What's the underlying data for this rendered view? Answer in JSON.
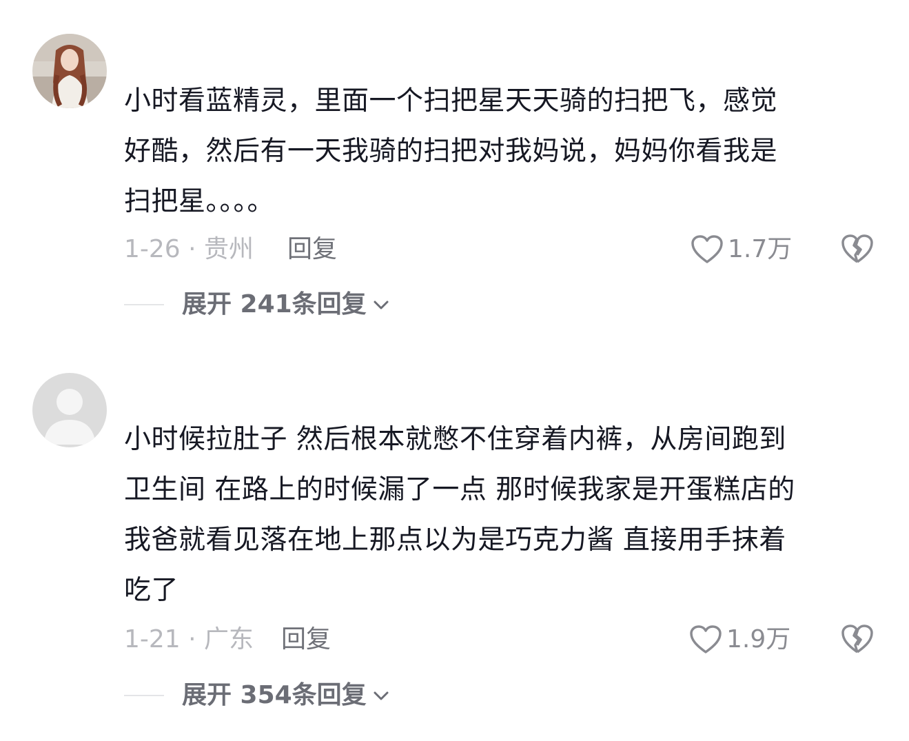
{
  "comments": [
    {
      "avatar": "user-photo-avatar",
      "text_lines": [
        "小时看蓝精灵，里面一个扫把星天天骑的扫把飞，感觉",
        "好酷，然后有一天我骑的扫把对我妈说，妈妈你看我是",
        "扫把星。。。。"
      ],
      "date_location": "1-26 · 贵州",
      "reply_label": "回复",
      "like_count": "1.7万",
      "expand_label": "展开 241条回复"
    },
    {
      "avatar": "default-user-avatar",
      "text_lines": [
        "小时候拉肚子 然后根本就憋不住穿着内裤，从房间跑到",
        "卫生间 在路上的时候漏了一点 那时候我家是开蛋糕店的",
        "我爸就看见落在地上那点以为是巧克力酱 直接用手抹着",
        "吃了"
      ],
      "date_location": "1-21 · 广东",
      "reply_label": "回复",
      "like_count": "1.9万",
      "expand_label": "展开 354条回复"
    }
  ],
  "icons": {
    "like": "heart-outline-icon",
    "dislike": "broken-heart-icon",
    "expand": "chevron-down-icon"
  },
  "colors": {
    "text": "#161823",
    "meta": "#b7b8bd",
    "reply": "#6f7178",
    "icon": "#8a8b91",
    "expand": "#6b6d75"
  }
}
